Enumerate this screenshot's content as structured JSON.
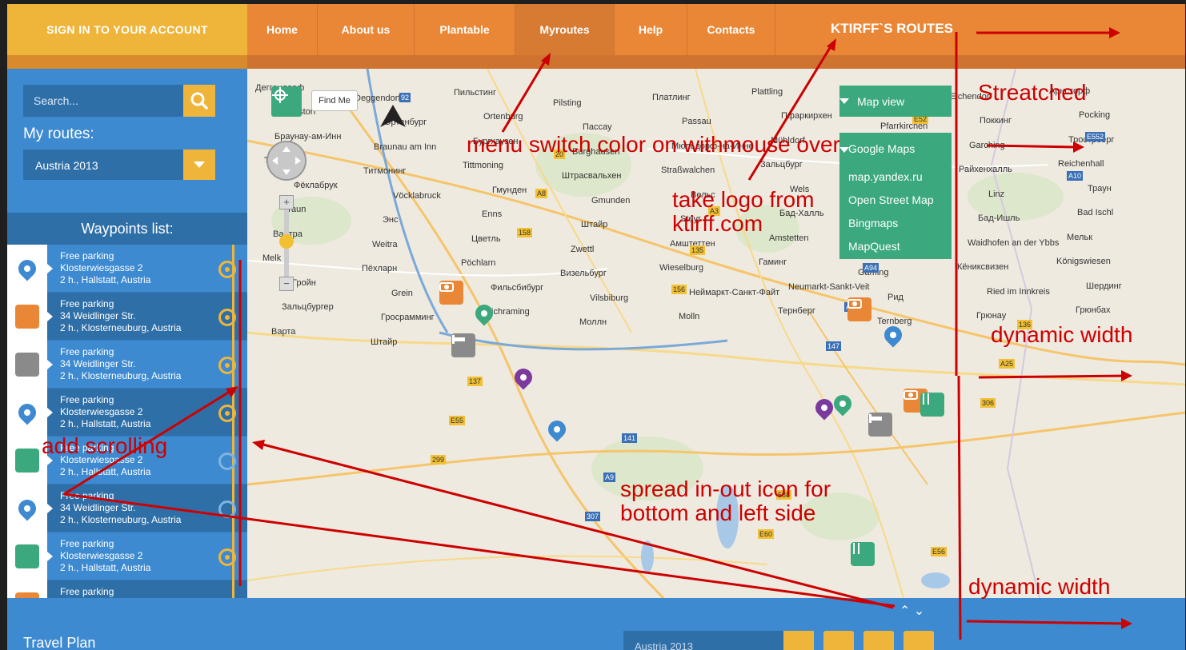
{
  "header": {
    "signin_label": "SIGN IN TO YOUR ACCOUNT",
    "nav": [
      {
        "label": "Home",
        "active": false
      },
      {
        "label": "About us",
        "active": false
      },
      {
        "label": "Plantable",
        "active": false
      },
      {
        "label": "Myroutes",
        "active": true
      },
      {
        "label": "Help",
        "active": false
      },
      {
        "label": "Contacts",
        "active": false
      }
    ],
    "logo_text": "KTIRFF`S ROUTES"
  },
  "sidebar": {
    "search_placeholder": "Search...",
    "routes_label": "My routes:",
    "route_selected": "Austria 2013",
    "waypoints_title": "Waypoints list:",
    "waypoints": [
      {
        "icon": "location-pin-icon",
        "color": "#3d8ad1",
        "title": "Free parking",
        "address": "Klosterwiesgasse 2",
        "meta": "2 h., Hallstatt, Austria"
      },
      {
        "icon": "camera-icon",
        "color": "#ea8736",
        "title": "Free parking",
        "address": "34 Weidlinger Str.",
        "meta": "2 h., Klosterneuburg, Austria"
      },
      {
        "icon": "bed-icon",
        "color": "#8a8a8a",
        "title": "Free parking",
        "address": "34 Weidlinger Str.",
        "meta": "2 h., Klosterneuburg, Austria"
      },
      {
        "icon": "location-pin-icon",
        "color": "#3d8ad1",
        "title": "Free parking",
        "address": "Klosterwiesgasse 2",
        "meta": "2 h., Hallstatt, Austria"
      },
      {
        "icon": "restaurant-icon",
        "color": "#3ba97d",
        "title": "Free parking",
        "address": "Klosterwiesgasse 2",
        "meta": "2 h., Hallstatt, Austria"
      },
      {
        "icon": "location-pin-icon",
        "color": "#3d8ad1",
        "title": "Free parking",
        "address": "34 Weidlinger Str.",
        "meta": "2 h., Klosterneuburg, Austria"
      },
      {
        "icon": "restaurant-icon",
        "color": "#3ba97d",
        "title": "Free parking",
        "address": "Klosterwiesgasse 2",
        "meta": "2 h., Hallstatt, Austria"
      },
      {
        "icon": "camera-icon",
        "color": "#ea8736",
        "title": "Free parking",
        "address": "",
        "meta": ""
      }
    ]
  },
  "map": {
    "findme_label": "Find Me",
    "mapview_label": "Map view",
    "provider_selected": "Google Maps",
    "providers": [
      "map.yandex.ru",
      "Open Street Map",
      "Bingmaps",
      "MapQuest"
    ],
    "places": [
      "Деггендорф",
      "Deggendorf",
      "Пильстинг",
      "Pilsting",
      "Платлинг",
      "Plattling",
      "Айхендорф",
      "Eichendorf",
      "Арнсторф",
      "Arnstorf",
      "Ортенбург",
      "Ortenburg",
      "Пассау",
      "Passau",
      "Пфаркирхен",
      "Pfarrkirchen",
      "Поккинг",
      "Pocking",
      "Браунау-ам-Инн",
      "Braunau am Inn",
      "Бургхаузен",
      "Burghausen",
      "Мюльдорф-на-Инне",
      "Mühldorf",
      "Гархинг-на-Альце",
      "Garching",
      "Трострберг",
      "Trostberg",
      "Титмонинг",
      "Tittmoning",
      "Штрасвальхен",
      "Straßwalchen",
      "Зальцбург",
      "Salzburg",
      "Райхенхалль",
      "Reichenhall",
      "Фёклабрук",
      "Vöcklabruck",
      "Гмунден",
      "Gmunden",
      "Вельс",
      "Wels",
      "Линц",
      "Linz",
      "Траун",
      "Traun",
      "Энс",
      "Enns",
      "Штайр",
      "Steyr",
      "Бад-Халль",
      "Bad Hall",
      "Бад-Ишль",
      "Bad Ischl",
      "Вайтра",
      "Weitra",
      "Цветль",
      "Zwettl",
      "Амштеттен",
      "Amstetten",
      "Байдхофен-на-Ибсе",
      "Waidhofen an der Ybbs",
      "Мельк",
      "Melk",
      "Пёхларн",
      "Pöchlarn",
      "Визельбург",
      "Wieselburg",
      "Гаминг",
      "Gaming",
      "Кёниксвизен",
      "Königswiesen",
      "Гройн",
      "Grein",
      "Фильсбибург",
      "Vilsbiburg",
      "Неймаркт-Санкт-Файт",
      "Neumarkt-Sankt-Veit",
      "Рид",
      "Ried im Innkreis",
      "Шердинг",
      "Зальцбургер",
      "Гросрамминг",
      "Reichraming",
      "Моллн",
      "Molln",
      "Тернберг",
      "Ternberg",
      "Грюнау",
      "Грюнбах",
      "Варта",
      "Штайр"
    ],
    "shields": [
      "92",
      "20",
      "A3",
      "A94",
      "136",
      "137",
      "141",
      "588",
      "E56",
      "E552",
      "A8",
      "135",
      "A1",
      "A25",
      "E55",
      "A9",
      "E60",
      "E52",
      "A10",
      "158",
      "156",
      "147",
      "306",
      "299",
      "307"
    ]
  },
  "bottom": {
    "arrows": "⌃ ⌄",
    "travel_plan_label": "Travel Plan",
    "plan_select": "Austria 2013"
  },
  "annotations": {
    "menu_hover": "menu  switch color on withmouse over",
    "logo": "take logo from ktirff.com",
    "streached": "Streatched",
    "dynamic_width_1": "dynamic width",
    "dynamic_width_2": "dynamic width",
    "scrolling": "add scrolling",
    "spread_icon": "spread in-out icon for bottom and left side"
  }
}
